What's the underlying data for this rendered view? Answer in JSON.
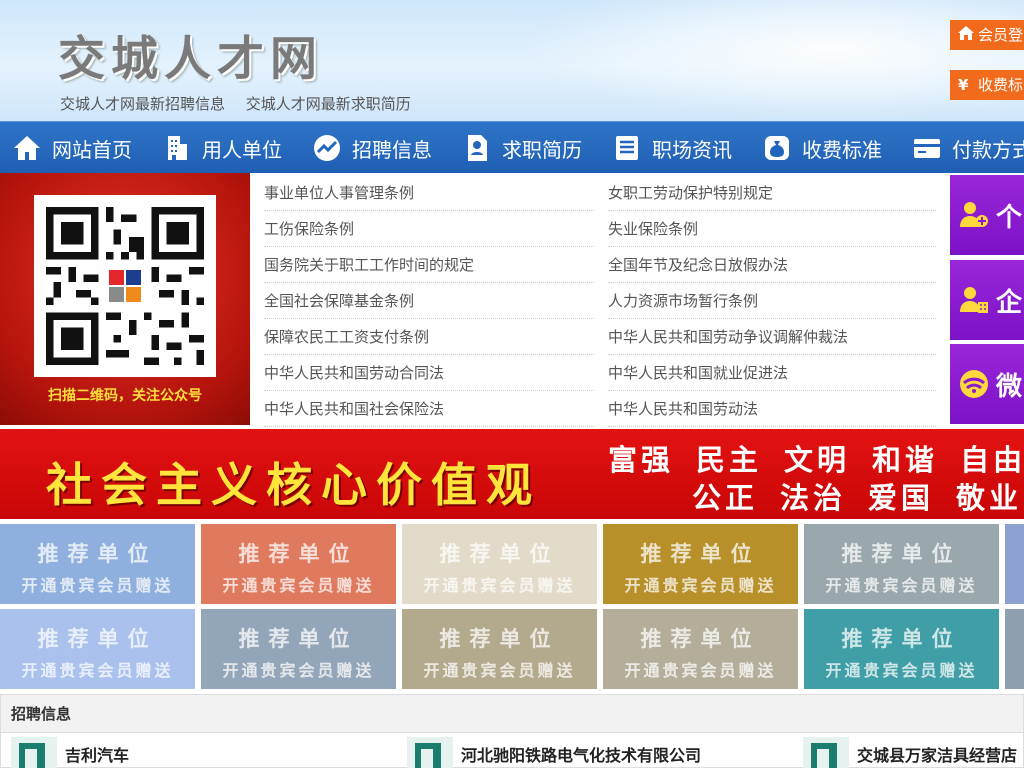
{
  "colors": {
    "nav_bg": "#2166bc",
    "accent_orange": "#f26b1d",
    "purple": "#8a1bd0",
    "banner_red": "#d80a0a",
    "banner_gold": "#ffe43c"
  },
  "header": {
    "site_title": "交城人才网",
    "links": [
      "交城人才网最新招聘信息",
      "交城人才网最新求职简历"
    ],
    "login_label": "会员登",
    "fee_label": "收费标"
  },
  "nav": [
    {
      "label": "网站首页",
      "icon": "home-icon"
    },
    {
      "label": "用人单位",
      "icon": "building-icon"
    },
    {
      "label": "招聘信息",
      "icon": "chart-icon"
    },
    {
      "label": "求职简历",
      "icon": "resume-icon"
    },
    {
      "label": "职场资讯",
      "icon": "news-icon"
    },
    {
      "label": "收费标准",
      "icon": "money-bag-icon"
    },
    {
      "label": "付款方式",
      "icon": "card-icon"
    }
  ],
  "qr": {
    "caption": "扫描二维码，关注公众号"
  },
  "laws": [
    "事业单位人事管理条例",
    "女职工劳动保护特别规定",
    "工伤保险条例",
    "失业保险条例",
    "国务院关于职工工作时间的规定",
    "全国年节及纪念日放假办法",
    "全国社会保障基金条例",
    "人力资源市场暂行条例",
    "保障农民工工资支付条例",
    "中华人民共和国劳动争议调解仲裁法",
    "中华人民共和国劳动合同法",
    "中华人民共和国就业促进法",
    "中华人民共和国社会保险法",
    "中华人民共和国劳动法"
  ],
  "side_cards": [
    {
      "label": "个",
      "icon": "person-add-icon"
    },
    {
      "label": "企",
      "icon": "company-user-icon"
    },
    {
      "label": "微",
      "icon": "wechat-icon"
    }
  ],
  "banner": {
    "main": "社会主义核心价值观",
    "row1": [
      "富强",
      "民主",
      "文明",
      "和谐",
      "自由"
    ],
    "row2": [
      "公正",
      "法治",
      "爱国",
      "敬业"
    ]
  },
  "recommend": {
    "title": "推荐单位",
    "subtitle": "开通贵宾会员赠送",
    "colors_row1": [
      "#8fb0de",
      "#e07a5f",
      "#e3dbc9",
      "#b8902a",
      "#9aa7ad",
      "#8da1d0"
    ],
    "colors_row2": [
      "#a9c1ec",
      "#93a5b8",
      "#b3a98c",
      "#b3ad9a",
      "#3f9ea6",
      "#8ea0b0"
    ]
  },
  "jobs": {
    "header": "招聘信息",
    "items": [
      "吉利汽车",
      "河北驰阳铁路电气化技术有限公司",
      "交城县万家洁具经营店"
    ]
  }
}
